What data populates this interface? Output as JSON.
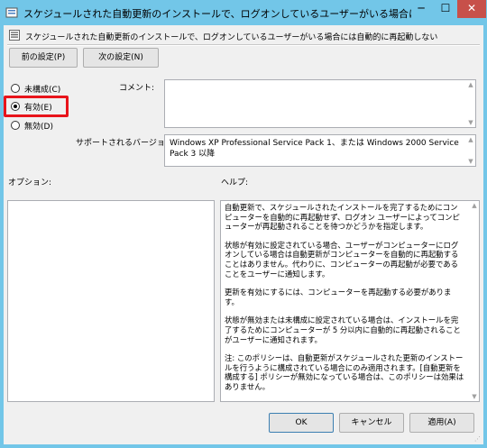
{
  "window": {
    "title": "スケジュールされた自動更新のインストールで、ログオンしているユーザーがいる場合には自動的..."
  },
  "window_buttons": {
    "minimize": "─",
    "maximize": "☐",
    "close": "✕"
  },
  "policy": {
    "name": "スケジュールされた自動更新のインストールで、ログオンしているユーザーがいる場合には自動的に再起動しない"
  },
  "nav": {
    "prev_label": "前の設定(P)",
    "next_label": "次の設定(N)"
  },
  "state_options": {
    "not_configured": "未構成(C)",
    "enabled": "有効(E)",
    "disabled": "無効(D)",
    "selected": "enabled"
  },
  "comment": {
    "label": "コメント:",
    "value": ""
  },
  "supported": {
    "label": "サポートされるバージョン:",
    "value": "Windows XP Professional Service Pack 1、または Windows 2000 Service Pack 3 以降"
  },
  "options": {
    "label": "オプション:"
  },
  "help": {
    "label": "ヘルプ:",
    "paragraphs": [
      "自動更新で、スケジュールされたインストールを完了するためにコンピューターを自動的に再起動せず、ログオン ユーザーによってコンピューターが再起動されることを待つかどうかを指定します。",
      "状態が有効に設定されている場合、ユーザーがコンピューターにログオンしている場合は自動更新がコンピューターを自動的に再起動することはありません。代わりに、コンピューターの再起動が必要であることをユーザーに通知します。",
      "更新を有効にするには、コンピューターを再起動する必要があります。",
      "状態が無効または未構成に設定されている場合は、インストールを完了するためにコンピューターが 5 分以内に自動的に再起動されることがユーザーに通知されます。",
      "注: このポリシーは、自動更新がスケジュールされた更新のインストールを行うように構成されている場合にのみ適用されます。[自動更新を構成する] ポリシーが無効になっている場合は、このポリシーは効果はありません。"
    ]
  },
  "footer": {
    "ok": "OK",
    "cancel": "キャンセル",
    "apply": "適用(A)"
  },
  "colors": {
    "title_bar": "#72c6e8",
    "highlight": "#e8141b",
    "close_button": "#c7504a"
  }
}
